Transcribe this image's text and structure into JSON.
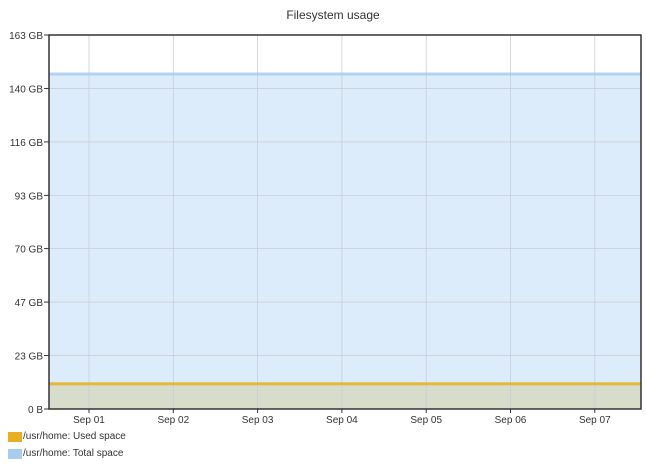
{
  "chart_data": {
    "type": "area",
    "title": "Filesystem usage",
    "xlabel": "",
    "ylabel": "",
    "x_ticks": [
      "Sep 01",
      "Sep 02",
      "Sep 03",
      "Sep 04",
      "Sep 05",
      "Sep 06",
      "Sep 07"
    ],
    "y_ticks": [
      "0 B",
      "23 GB",
      "47 GB",
      "70 GB",
      "93 GB",
      "116 GB",
      "140 GB",
      "163 GB"
    ],
    "y_tick_values": [
      0,
      23.3,
      46.6,
      69.9,
      93.1,
      116.4,
      139.7,
      163
    ],
    "ylim": [
      0,
      163
    ],
    "xlim": [
      "Aug 31",
      "Sep 07"
    ],
    "grid": true,
    "legend_position": "bottom-left",
    "series": [
      {
        "name": "/usr/home: Used space",
        "color": "#e8b020",
        "fill": "#d8dccb",
        "x": [
          "Aug 31",
          "Sep 01",
          "Sep 02",
          "Sep 03",
          "Sep 04",
          "Sep 05",
          "Sep 06",
          "Sep 07"
        ],
        "values": [
          11,
          11,
          11,
          11,
          11,
          11,
          11,
          11
        ]
      },
      {
        "name": "/usr/home: Total space",
        "color": "#a6cdf0",
        "fill": "#ddecfa",
        "x": [
          "Aug 31",
          "Sep 01",
          "Sep 02",
          "Sep 03",
          "Sep 04",
          "Sep 05",
          "Sep 06",
          "Sep 07"
        ],
        "values": [
          146,
          146,
          146,
          146,
          146,
          146,
          146,
          146
        ]
      }
    ]
  }
}
